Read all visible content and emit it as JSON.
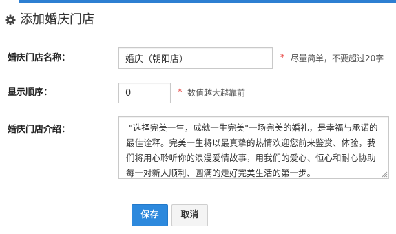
{
  "header": {
    "title": "添加婚庆门店",
    "icon": "gear-icon"
  },
  "form": {
    "name": {
      "label": "婚庆门店名称：",
      "value": "婚庆（朝阳店）",
      "required_mark": "*",
      "hint": "尽量简单，不要超过20字"
    },
    "order": {
      "label": "显示顺序：",
      "value": "0",
      "required_mark": "*",
      "hint": "数值越大越靠前"
    },
    "intro": {
      "label": "婚庆门店介绍：",
      "value": " \"选择完美一生，成就一生完美\"一场完美的婚礼，是幸福与承诺的最佳诠释。完美一生将以最真挚的热情欢迎您前来鉴赏、体验，我们将用心聆听你的浪漫爱情故事，用我们的爱心、恒心和耐心协助每一对新人顺利、圆满的走好完美生活的第一步。"
    }
  },
  "buttons": {
    "save": "保存",
    "cancel": "取消"
  },
  "colors": {
    "accent": "#2d89dd",
    "required": "#e53935"
  }
}
